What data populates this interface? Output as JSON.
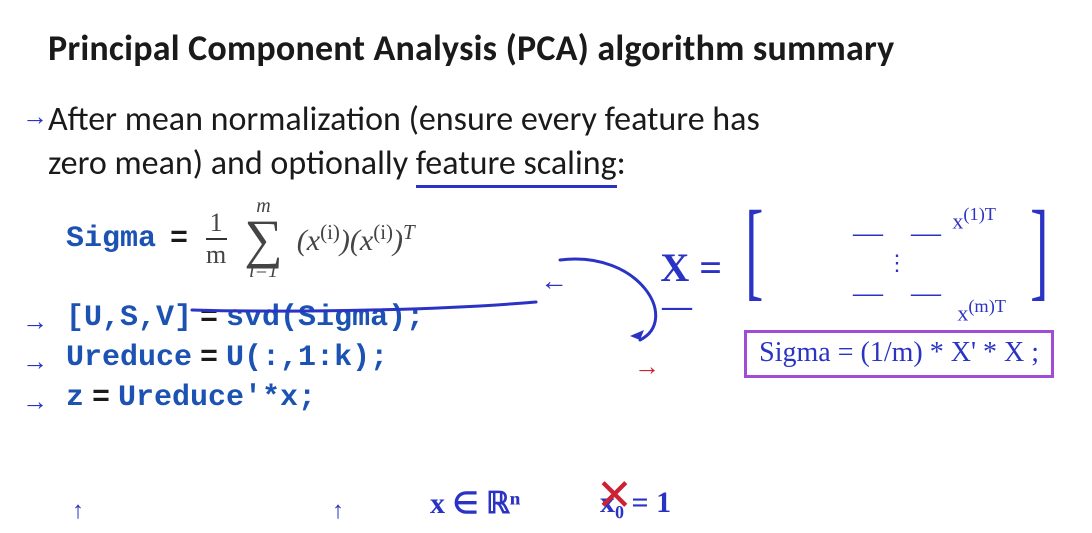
{
  "title": "Principal Component Analysis (PCA) algorithm summary",
  "body_line1": "After mean normalization (ensure every feature has",
  "body_line2a": "zero mean) and optionally ",
  "body_line2b": "feature scaling",
  "body_line2c": ":",
  "sigma_label": "Sigma",
  "eq_equals": "=",
  "frac_num": "1",
  "frac_den": "m",
  "sum_top": "m",
  "sum_bot": "i=1",
  "term1": "(x",
  "term1_sup": "(i)",
  "term1_close": ")",
  "term2": "(x",
  "term2_sup": "(i)",
  "term2_close": ")",
  "term_T": "T",
  "code1_lhs": "[U,S,V]",
  "code1_rhs": "svd(Sigma);",
  "code2_lhs": "Ureduce",
  "code2_rhs": "U(:,1:k);",
  "code3_lhs": "z",
  "code3_rhs": "Ureduce'*x;",
  "hand": {
    "arrow": "→",
    "up": "↑",
    "left_arrow_eq": "←",
    "X_eq": "X =",
    "dash": "—",
    "mat_top_label": "x",
    "mat_top_sup": "(1)T",
    "mat_bot_label": "x",
    "mat_bot_sup": "(m)T",
    "dots": "⋮",
    "boxed_sigma": "Sigma = (1/m) * X' * X ;",
    "x_in_Rn": "x ∈ ℝⁿ",
    "x0_eq_1": "x₀ = 1",
    "matrix_lbr": "[",
    "matrix_rbr": "]",
    "red_arrow": "→"
  }
}
